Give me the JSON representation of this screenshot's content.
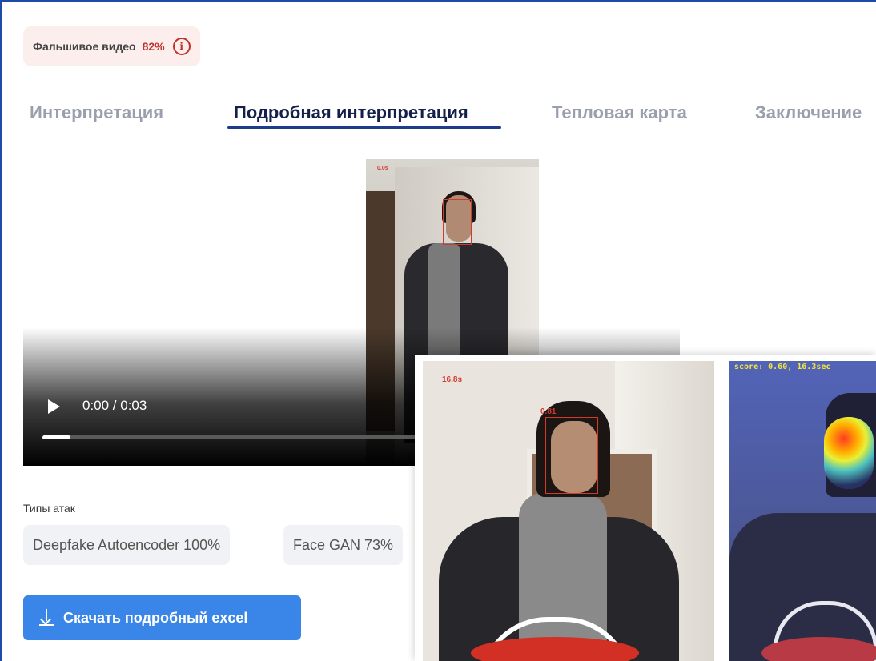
{
  "verdict": {
    "label": "Фальшивое видео",
    "percent": "82%",
    "icon": "info-icon",
    "color": "#c0322b"
  },
  "tabs": [
    {
      "label": "Интерпретация",
      "active": false
    },
    {
      "label": "Подробная интерпретация",
      "active": true
    },
    {
      "label": "Тепловая карта",
      "active": false
    },
    {
      "label": "Заключение",
      "active": false
    }
  ],
  "video": {
    "frame_timestamp": "0.0s",
    "face_score": "0.81",
    "time": "0:00 / 0:03",
    "progress": 0.045,
    "play_icon": "play-icon"
  },
  "attacks": {
    "label": "Типы атак",
    "items": [
      {
        "label": "Deepfake Autoencoder 100%"
      },
      {
        "label": "Face GAN 73%"
      }
    ]
  },
  "download": {
    "label": "Скачать подробный excel",
    "icon": "download-icon",
    "color": "#3a86e8"
  },
  "frames": {
    "detection": {
      "timestamp": "16.8s",
      "score": "0.81"
    },
    "heatmap": {
      "caption": "score: 0.60, 16.3sec"
    }
  }
}
